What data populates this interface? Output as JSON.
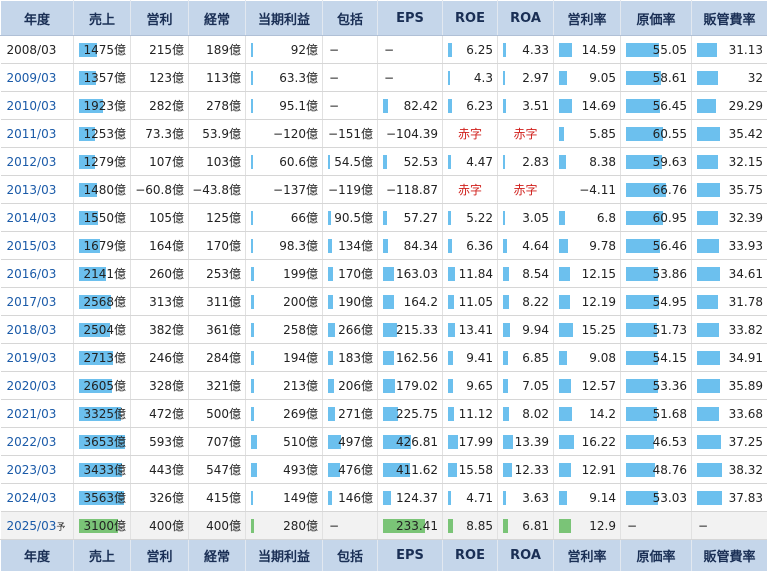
{
  "columns": [
    "年度",
    "売上",
    "営利",
    "経常",
    "当期利益",
    "包括",
    "EPS",
    "ROE",
    "ROA",
    "営利率",
    "原価率",
    "販管費率"
  ],
  "colors": {
    "header_bg": "#c5d6ea",
    "bar_blue": "#6cc0ee",
    "bar_green": "#7ac477",
    "deficit_red": "#d0201c",
    "year_link": "#1a5aa8"
  },
  "rows": [
    {
      "year": "2008/03",
      "sales": "1475億",
      "op": "215億",
      "ord": "189億",
      "net": "92億",
      "comp": "−",
      "eps": "−",
      "roe": "6.25",
      "roa": "4.33",
      "opm": "14.59",
      "cogs": "55.05",
      "sga": "31.13"
    },
    {
      "year": "2009/03",
      "sales": "1357億",
      "op": "123億",
      "ord": "113億",
      "net": "63.3億",
      "comp": "−",
      "eps": "−",
      "roe": "4.3",
      "roa": "2.97",
      "opm": "9.05",
      "cogs": "58.61",
      "sga": "32"
    },
    {
      "year": "2010/03",
      "sales": "1923億",
      "op": "282億",
      "ord": "278億",
      "net": "95.1億",
      "comp": "−",
      "eps": "82.42",
      "roe": "6.23",
      "roa": "3.51",
      "opm": "14.69",
      "cogs": "56.45",
      "sga": "29.29"
    },
    {
      "year": "2011/03",
      "sales": "1253億",
      "op": "73.3億",
      "ord": "53.9億",
      "net": "−120億",
      "comp": "−151億",
      "eps": "−104.39",
      "roe": "赤字",
      "roa": "赤字",
      "opm": "5.85",
      "cogs": "60.55",
      "sga": "35.42"
    },
    {
      "year": "2012/03",
      "sales": "1279億",
      "op": "107億",
      "ord": "103億",
      "net": "60.6億",
      "comp": "54.5億",
      "eps": "52.53",
      "roe": "4.47",
      "roa": "2.83",
      "opm": "8.38",
      "cogs": "59.63",
      "sga": "32.15"
    },
    {
      "year": "2013/03",
      "sales": "1480億",
      "op": "−60.8億",
      "ord": "−43.8億",
      "net": "−137億",
      "comp": "−119億",
      "eps": "−118.87",
      "roe": "赤字",
      "roa": "赤字",
      "opm": "−4.11",
      "cogs": "66.76",
      "sga": "35.75"
    },
    {
      "year": "2014/03",
      "sales": "1550億",
      "op": "105億",
      "ord": "125億",
      "net": "66億",
      "comp": "90.5億",
      "eps": "57.27",
      "roe": "5.22",
      "roa": "3.05",
      "opm": "6.8",
      "cogs": "60.95",
      "sga": "32.39"
    },
    {
      "year": "2015/03",
      "sales": "1679億",
      "op": "164億",
      "ord": "170億",
      "net": "98.3億",
      "comp": "134億",
      "eps": "84.34",
      "roe": "6.36",
      "roa": "4.64",
      "opm": "9.78",
      "cogs": "56.46",
      "sga": "33.93"
    },
    {
      "year": "2016/03",
      "sales": "2141億",
      "op": "260億",
      "ord": "253億",
      "net": "199億",
      "comp": "170億",
      "eps": "163.03",
      "roe": "11.84",
      "roa": "8.54",
      "opm": "12.15",
      "cogs": "53.86",
      "sga": "34.61"
    },
    {
      "year": "2017/03",
      "sales": "2568億",
      "op": "313億",
      "ord": "311億",
      "net": "200億",
      "comp": "190億",
      "eps": "164.2",
      "roe": "11.05",
      "roa": "8.22",
      "opm": "12.19",
      "cogs": "54.95",
      "sga": "31.78"
    },
    {
      "year": "2018/03",
      "sales": "2504億",
      "op": "382億",
      "ord": "361億",
      "net": "258億",
      "comp": "266億",
      "eps": "215.33",
      "roe": "13.41",
      "roa": "9.94",
      "opm": "15.25",
      "cogs": "51.73",
      "sga": "33.82"
    },
    {
      "year": "2019/03",
      "sales": "2713億",
      "op": "246億",
      "ord": "284億",
      "net": "194億",
      "comp": "183億",
      "eps": "162.56",
      "roe": "9.41",
      "roa": "6.85",
      "opm": "9.08",
      "cogs": "54.15",
      "sga": "34.91"
    },
    {
      "year": "2020/03",
      "sales": "2605億",
      "op": "328億",
      "ord": "321億",
      "net": "213億",
      "comp": "206億",
      "eps": "179.02",
      "roe": "9.65",
      "roa": "7.05",
      "opm": "12.57",
      "cogs": "53.36",
      "sga": "35.89"
    },
    {
      "year": "2021/03",
      "sales": "3325億",
      "op": "472億",
      "ord": "500億",
      "net": "269億",
      "comp": "271億",
      "eps": "225.75",
      "roe": "11.12",
      "roa": "8.02",
      "opm": "14.2",
      "cogs": "51.68",
      "sga": "33.68"
    },
    {
      "year": "2022/03",
      "sales": "3653億",
      "op": "593億",
      "ord": "707億",
      "net": "510億",
      "comp": "497億",
      "eps": "426.81",
      "roe": "17.99",
      "roa": "13.39",
      "opm": "16.22",
      "cogs": "46.53",
      "sga": "37.25"
    },
    {
      "year": "2023/03",
      "sales": "3433億",
      "op": "443億",
      "ord": "547億",
      "net": "493億",
      "comp": "476億",
      "eps": "411.62",
      "roe": "15.58",
      "roa": "12.33",
      "opm": "12.91",
      "cogs": "48.76",
      "sga": "38.32"
    },
    {
      "year": "2024/03",
      "sales": "3563億",
      "op": "326億",
      "ord": "415億",
      "net": "149億",
      "comp": "146億",
      "eps": "124.37",
      "roe": "4.71",
      "roa": "3.63",
      "opm": "9.14",
      "cogs": "53.03",
      "sga": "37.83"
    },
    {
      "year": "2025/03",
      "year_mark": "予",
      "sales": "3100億",
      "op": "400億",
      "ord": "400億",
      "net": "280億",
      "comp": "−",
      "eps": "233.41",
      "roe": "8.85",
      "roa": "6.81",
      "opm": "12.9",
      "cogs": "−",
      "sga": "−"
    }
  ],
  "bars": [
    {
      "sales": 0.4,
      "op": 0,
      "ord": 0,
      "net": 0.02,
      "comp": 0,
      "eps": 0,
      "roe": 0.08,
      "roa": 0.07,
      "opm": 0.24,
      "cogs": 0.55,
      "sga": 0.31
    },
    {
      "sales": 0.37,
      "op": 0,
      "ord": 0,
      "net": 0.02,
      "comp": 0,
      "eps": 0,
      "roe": 0.05,
      "roa": 0.05,
      "opm": 0.15,
      "cogs": 0.59,
      "sga": 0.32
    },
    {
      "sales": 0.52,
      "op": 0,
      "ord": 0,
      "net": 0.02,
      "comp": 0,
      "eps": 0.1,
      "roe": 0.08,
      "roa": 0.06,
      "opm": 0.24,
      "cogs": 0.56,
      "sga": 0.29
    },
    {
      "sales": 0.34,
      "op": 0,
      "ord": 0,
      "net": 0,
      "comp": 0,
      "eps": 0,
      "roe": 0,
      "roa": 0,
      "opm": 0.09,
      "cogs": 0.61,
      "sga": 0.35
    },
    {
      "sales": 0.35,
      "op": 0,
      "ord": 0,
      "net": 0.02,
      "comp": 0.05,
      "eps": 0.07,
      "roe": 0.06,
      "roa": 0.05,
      "opm": 0.13,
      "cogs": 0.6,
      "sga": 0.32
    },
    {
      "sales": 0.4,
      "op": 0,
      "ord": 0,
      "net": 0,
      "comp": 0,
      "eps": 0,
      "roe": 0,
      "roa": 0,
      "opm": 0,
      "cogs": 0.67,
      "sga": 0.36
    },
    {
      "sales": 0.42,
      "op": 0,
      "ord": 0,
      "net": 0.02,
      "comp": 0.07,
      "eps": 0.07,
      "roe": 0.07,
      "roa": 0.05,
      "opm": 0.11,
      "cogs": 0.61,
      "sga": 0.32
    },
    {
      "sales": 0.46,
      "op": 0,
      "ord": 0,
      "net": 0.02,
      "comp": 0.09,
      "eps": 0.1,
      "roe": 0.08,
      "roa": 0.08,
      "opm": 0.16,
      "cogs": 0.56,
      "sga": 0.34
    },
    {
      "sales": 0.58,
      "op": 0,
      "ord": 0,
      "net": 0.04,
      "comp": 0.11,
      "eps": 0.2,
      "roe": 0.15,
      "roa": 0.14,
      "opm": 0.2,
      "cogs": 0.54,
      "sga": 0.35
    },
    {
      "sales": 0.7,
      "op": 0,
      "ord": 0,
      "net": 0.04,
      "comp": 0.12,
      "eps": 0.2,
      "roe": 0.14,
      "roa": 0.14,
      "opm": 0.2,
      "cogs": 0.55,
      "sga": 0.32
    },
    {
      "sales": 0.68,
      "op": 0,
      "ord": 0,
      "net": 0.05,
      "comp": 0.16,
      "eps": 0.26,
      "roe": 0.17,
      "roa": 0.16,
      "opm": 0.25,
      "cogs": 0.52,
      "sga": 0.34
    },
    {
      "sales": 0.74,
      "op": 0,
      "ord": 0,
      "net": 0.04,
      "comp": 0.12,
      "eps": 0.2,
      "roe": 0.12,
      "roa": 0.11,
      "opm": 0.15,
      "cogs": 0.54,
      "sga": 0.35
    },
    {
      "sales": 0.71,
      "op": 0,
      "ord": 0,
      "net": 0.04,
      "comp": 0.13,
      "eps": 0.22,
      "roe": 0.12,
      "roa": 0.12,
      "opm": 0.21,
      "cogs": 0.53,
      "sga": 0.36
    },
    {
      "sales": 0.91,
      "op": 0,
      "ord": 0,
      "net": 0.05,
      "comp": 0.16,
      "eps": 0.28,
      "roe": 0.14,
      "roa": 0.13,
      "opm": 0.24,
      "cogs": 0.52,
      "sga": 0.34
    },
    {
      "sales": 1.0,
      "op": 0,
      "ord": 0,
      "net": 0.09,
      "comp": 0.29,
      "eps": 0.52,
      "roe": 0.23,
      "roa": 0.22,
      "opm": 0.27,
      "cogs": 0.47,
      "sga": 0.37
    },
    {
      "sales": 0.94,
      "op": 0,
      "ord": 0,
      "net": 0.09,
      "comp": 0.28,
      "eps": 0.5,
      "roe": 0.2,
      "roa": 0.2,
      "opm": 0.21,
      "cogs": 0.49,
      "sga": 0.38
    },
    {
      "sales": 0.97,
      "op": 0,
      "ord": 0,
      "net": 0.03,
      "comp": 0.09,
      "eps": 0.15,
      "roe": 0.06,
      "roa": 0.06,
      "opm": 0.15,
      "cogs": 0.53,
      "sga": 0.38
    },
    {
      "sales": 0.85,
      "op": 0,
      "ord": 0,
      "net": 0.05,
      "comp": 0,
      "eps": 0.78,
      "roe": 0.11,
      "roa": 0.11,
      "opm": 0.21,
      "cogs": 0,
      "sga": 0
    }
  ]
}
